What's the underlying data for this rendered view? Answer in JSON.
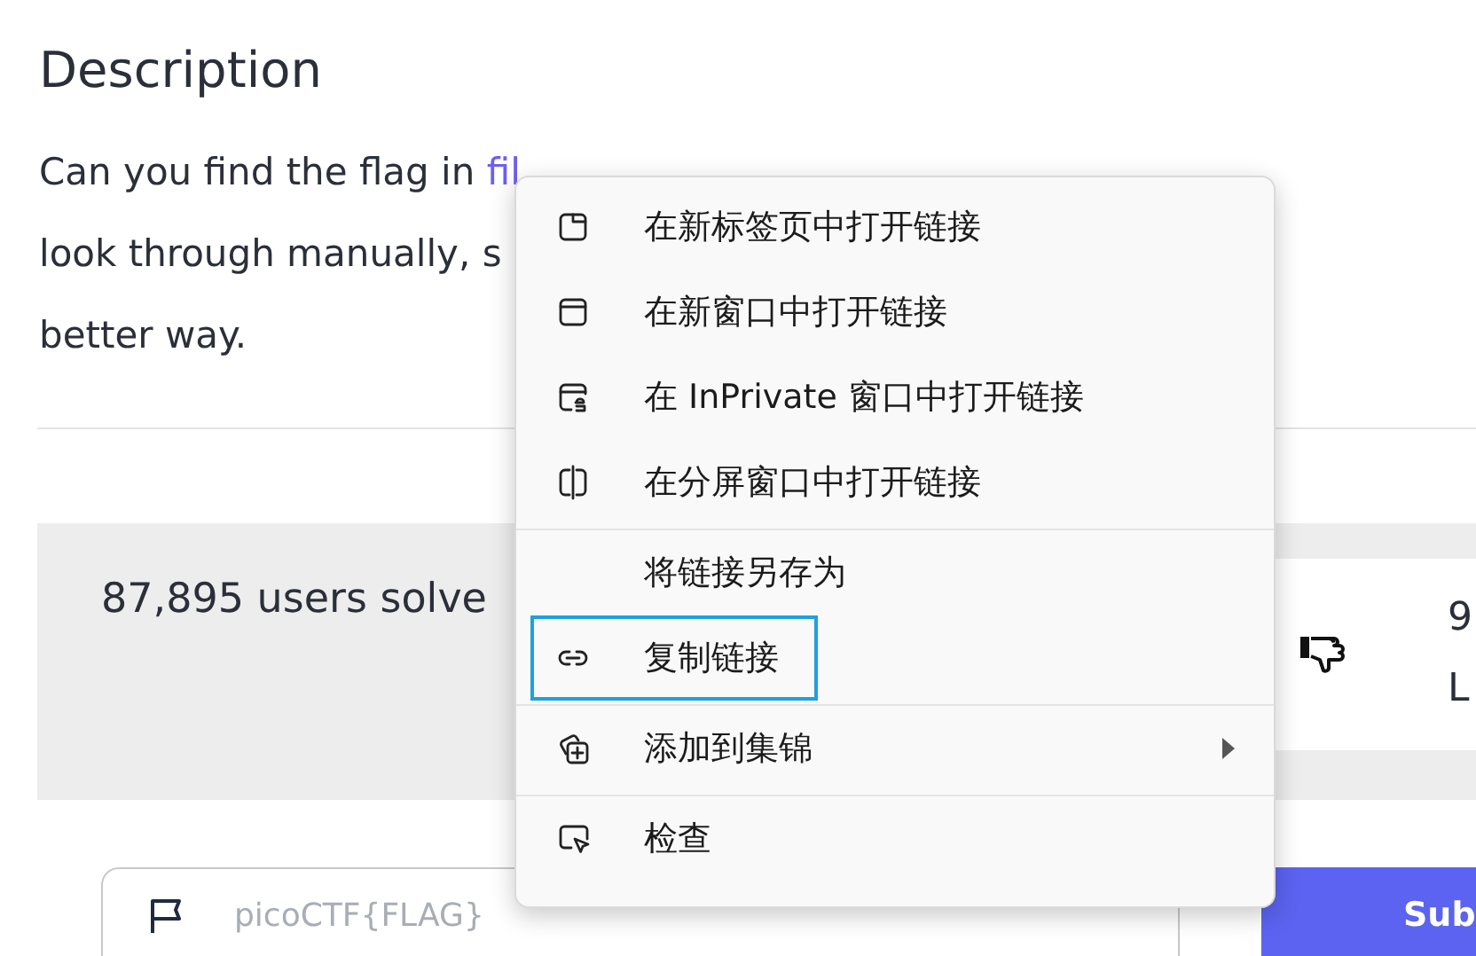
{
  "description": {
    "heading": "Description",
    "lines": [
      {
        "text": "Can you find the flag in ",
        "link": "fil"
      },
      {
        "text": "look through manually, s"
      },
      {
        "text": "better way."
      }
    ]
  },
  "stats": {
    "solved": "87,895 users solve",
    "card_texts": [
      "9",
      "L"
    ]
  },
  "flag_form": {
    "placeholder": "picoCTF{FLAG}",
    "submit": "Sub"
  },
  "context_menu": {
    "groups": [
      [
        {
          "label": "在新标签页中打开链接",
          "focused": false,
          "submenu": false
        },
        {
          "label": "在新窗口中打开链接",
          "focused": false,
          "submenu": false
        },
        {
          "label": "在 InPrivate 窗口中打开链接",
          "focused": false,
          "submenu": false
        },
        {
          "label": "在分屏窗口中打开链接",
          "focused": false,
          "submenu": false
        }
      ],
      [
        {
          "label": "将链接另存为",
          "focused": false,
          "submenu": false
        },
        {
          "label": "复制链接",
          "focused": true,
          "submenu": false
        }
      ],
      [
        {
          "label": "添加到集锦",
          "focused": false,
          "submenu": true
        }
      ],
      [
        {
          "label": "检查",
          "focused": false,
          "submenu": false
        }
      ]
    ]
  }
}
